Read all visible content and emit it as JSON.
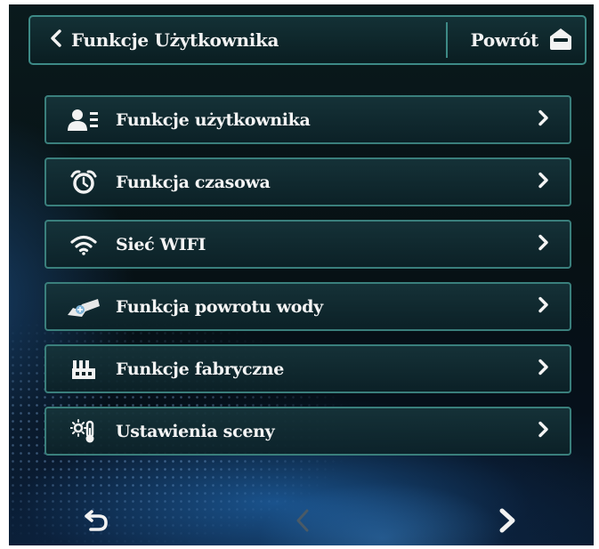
{
  "header": {
    "back_label": "Funkcje Użytkownika",
    "home_label": "Powrót",
    "back_icon": "chevron-left-icon",
    "home_icon": "home-icon"
  },
  "menu": {
    "items": [
      {
        "label": "Funkcje użytkownika",
        "icon": "user-list-icon"
      },
      {
        "label": "Funkcja czasowa",
        "icon": "alarm-clock-icon"
      },
      {
        "label": "Sieć WIFI",
        "icon": "wifi-icon"
      },
      {
        "label": "Funkcja powrotu wody",
        "icon": "water-return-icon"
      },
      {
        "label": "Funkcje fabryczne",
        "icon": "factory-icon"
      },
      {
        "label": "Ustawienia sceny",
        "icon": "scene-settings-icon"
      }
    ]
  },
  "bottom_nav": {
    "return_icon": "return-icon",
    "prev_icon": "chevron-left-icon",
    "next_icon": "chevron-right-icon"
  },
  "colors": {
    "border_accent": "#3d8a86",
    "text": "#f4f4f4",
    "prev_disabled": "#4a5a66"
  }
}
